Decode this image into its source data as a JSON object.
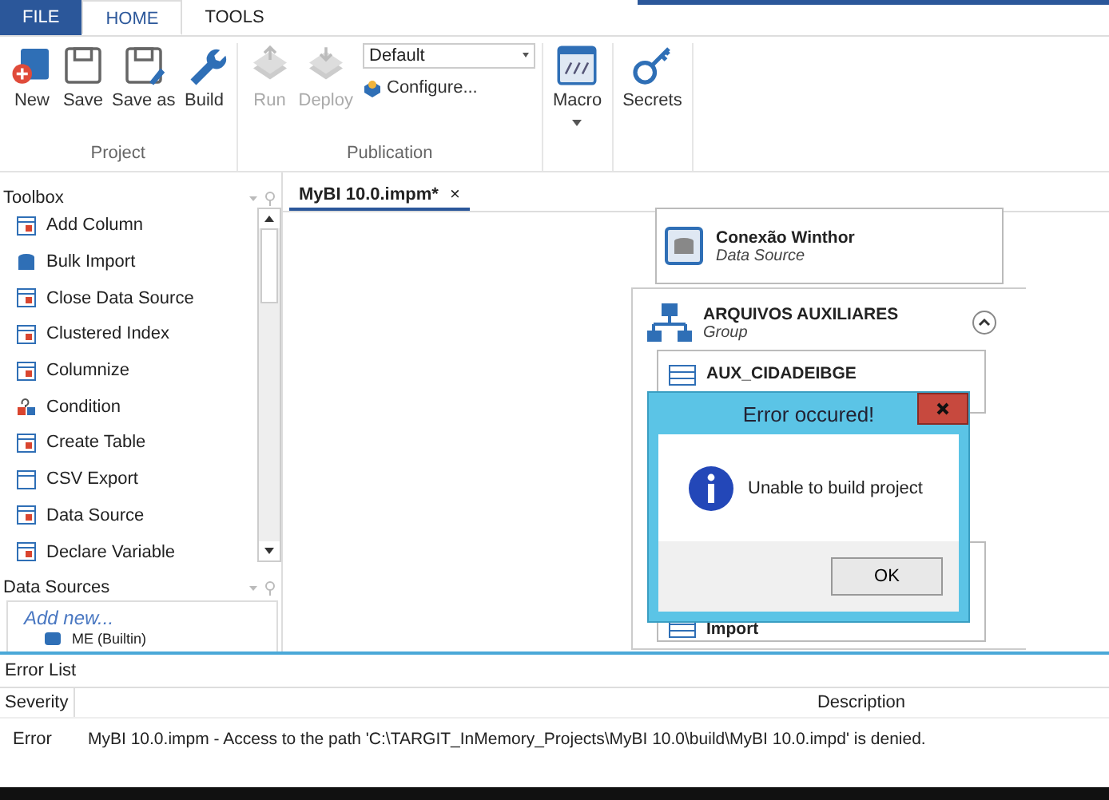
{
  "menu_tabs": [
    {
      "label": "FILE",
      "kind": "file",
      "selected": false
    },
    {
      "label": "HOME",
      "kind": "tab",
      "selected": true
    },
    {
      "label": "TOOLS",
      "kind": "tab",
      "selected": false
    }
  ],
  "ribbon": [
    {
      "label": "Project",
      "items": [
        {
          "kind": "big",
          "label": "New",
          "disabled": false
        },
        {
          "kind": "big",
          "label": "Save",
          "disabled": false
        },
        {
          "kind": "big",
          "label": "Save as",
          "disabled": false
        },
        {
          "kind": "big",
          "label": "Build",
          "disabled": false
        }
      ]
    },
    {
      "label": "Publication",
      "items": [
        {
          "kind": "big",
          "label": "Run",
          "disabled": true
        },
        {
          "kind": "big",
          "label": "Deploy",
          "disabled": true
        },
        {
          "kind": "combo",
          "value": "Default",
          "link": "Configure..."
        }
      ]
    },
    {
      "items": [
        {
          "kind": "big",
          "label": "Macro",
          "disabled": false,
          "dropdown": true
        }
      ]
    },
    {
      "items": [
        {
          "kind": "big",
          "label": "Secrets",
          "disabled": false
        }
      ]
    }
  ],
  "toolbox": {
    "title": "Toolbox",
    "items": [
      "Add Column",
      "Bulk Import",
      "Close Data Source",
      "Clustered Index",
      "Columnize",
      "Condition",
      "Create Table",
      "CSV Export",
      "Data Source",
      "Declare Variable"
    ]
  },
  "data_sources": {
    "title": "Data Sources",
    "add": "Add new...",
    "items": [
      "ME (Builtin)"
    ]
  },
  "document_tab": {
    "label": "MyBI 10.0.impm*",
    "close": "×"
  },
  "canvas": {
    "nodes": [
      {
        "kind": "node",
        "title": "Conexão Winthor",
        "subtitle": "Data Source"
      },
      {
        "kind": "group",
        "title": "ARQUIVOS AUXILIARES",
        "subtitle": "Group",
        "expanded": true,
        "children": [
          {
            "title": "AUX_CIDADEIBGE"
          },
          {
            "title": "Import"
          }
        ]
      }
    ]
  },
  "dialog": {
    "title": "Error occured!",
    "message": "Unable to build project",
    "button": "OK"
  },
  "error_list": {
    "title": "Error List",
    "columns": [
      "Severity",
      "Description"
    ],
    "rows": [
      {
        "severity": "Error",
        "description": "MyBI 10.0.impm - Access to the path 'C:\\TARGIT_InMemory_Projects\\MyBI 10.0\\build\\MyBI 10.0.impd' is denied."
      }
    ]
  }
}
